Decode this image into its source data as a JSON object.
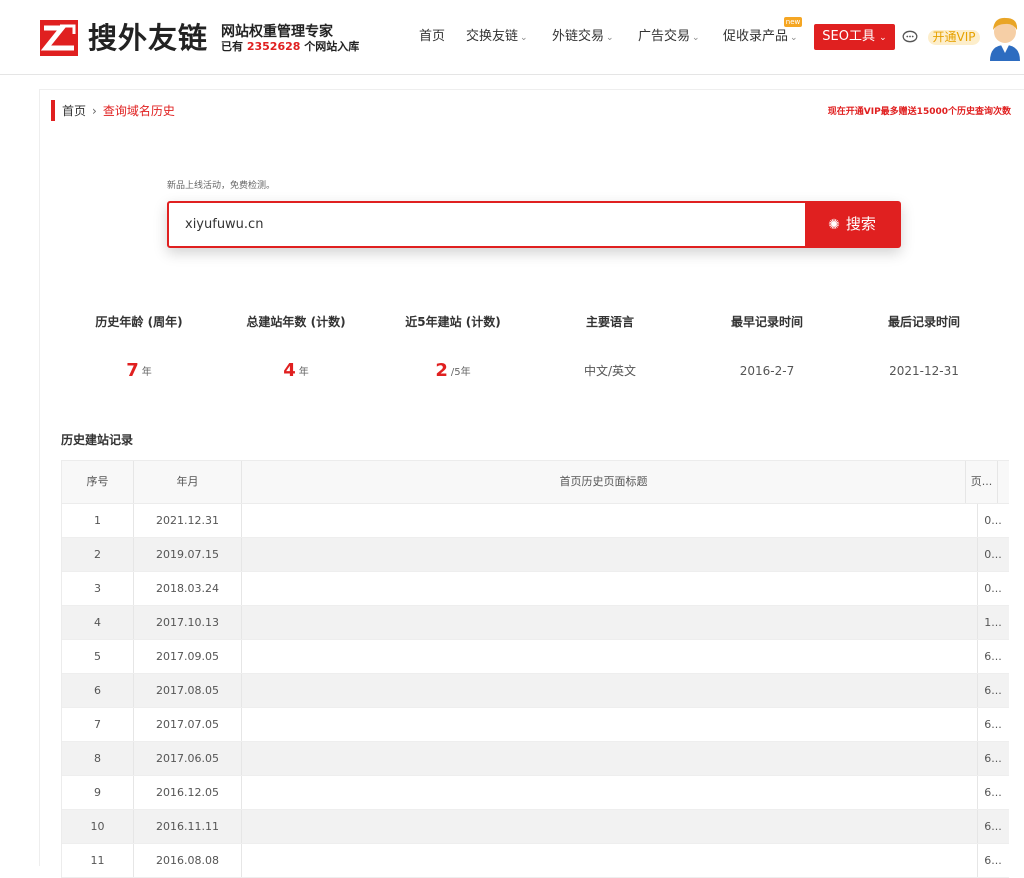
{
  "header": {
    "brand": "搜外友链",
    "slogan": "网站权重管理专家",
    "stats_prefix": "已有",
    "stats_count": "2352628",
    "stats_suffix": "个网站入库",
    "nav": [
      {
        "label": "首页",
        "has_dropdown": false
      },
      {
        "label": "交换友链",
        "has_dropdown": true
      },
      {
        "label": "外链交易",
        "has_dropdown": true
      },
      {
        "label": "广告交易",
        "has_dropdown": true
      },
      {
        "label": "促收录产品",
        "has_dropdown": true
      }
    ],
    "new_badge": "new",
    "seo_button": "SEO工具",
    "vip_button": "开通VIP",
    "accent_color": "#e02020"
  },
  "breadcrumb": {
    "home": "首页",
    "current": "查询域名历史"
  },
  "promo": "现在开通VIP最多赠送15000个历史查询次数",
  "search": {
    "hint": "新品上线活动，免费检测。",
    "value": "xiyufuwu.cn",
    "button": "搜索"
  },
  "stats": [
    {
      "label": "历史年龄 (周年)",
      "value": "7",
      "unit": "年",
      "big": true
    },
    {
      "label": "总建站年数 (计数)",
      "value": "4",
      "unit": "年",
      "big": true
    },
    {
      "label": "近5年建站 (计数)",
      "value": "2",
      "unit": "/5年",
      "big": true
    },
    {
      "label": "主要语言",
      "value": "中文/英文",
      "unit": "",
      "big": false
    },
    {
      "label": "最早记录时间",
      "value": "2016-2-7",
      "unit": "",
      "big": false
    },
    {
      "label": "最后记录时间",
      "value": "2021-12-31",
      "unit": "",
      "big": false
    }
  ],
  "history": {
    "title": "历史建站记录",
    "columns": [
      "序号",
      "年月",
      "首页历史页面标题",
      "页..."
    ],
    "rows": [
      {
        "no": "1",
        "date": "2021.12.31",
        "title": "",
        "extra": "0..."
      },
      {
        "no": "2",
        "date": "2019.07.15",
        "title": "",
        "extra": "0..."
      },
      {
        "no": "3",
        "date": "2018.03.24",
        "title": "",
        "extra": "0..."
      },
      {
        "no": "4",
        "date": "2017.10.13",
        "title": "",
        "extra": "1..."
      },
      {
        "no": "5",
        "date": "2017.09.05",
        "title": "",
        "extra": "6..."
      },
      {
        "no": "6",
        "date": "2017.08.05",
        "title": "",
        "extra": "6..."
      },
      {
        "no": "7",
        "date": "2017.07.05",
        "title": "",
        "extra": "6..."
      },
      {
        "no": "8",
        "date": "2017.06.05",
        "title": "",
        "extra": "6..."
      },
      {
        "no": "9",
        "date": "2016.12.05",
        "title": "",
        "extra": "6..."
      },
      {
        "no": "10",
        "date": "2016.11.11",
        "title": "",
        "extra": "6..."
      },
      {
        "no": "11",
        "date": "2016.08.08",
        "title": "",
        "extra": "6..."
      }
    ]
  }
}
